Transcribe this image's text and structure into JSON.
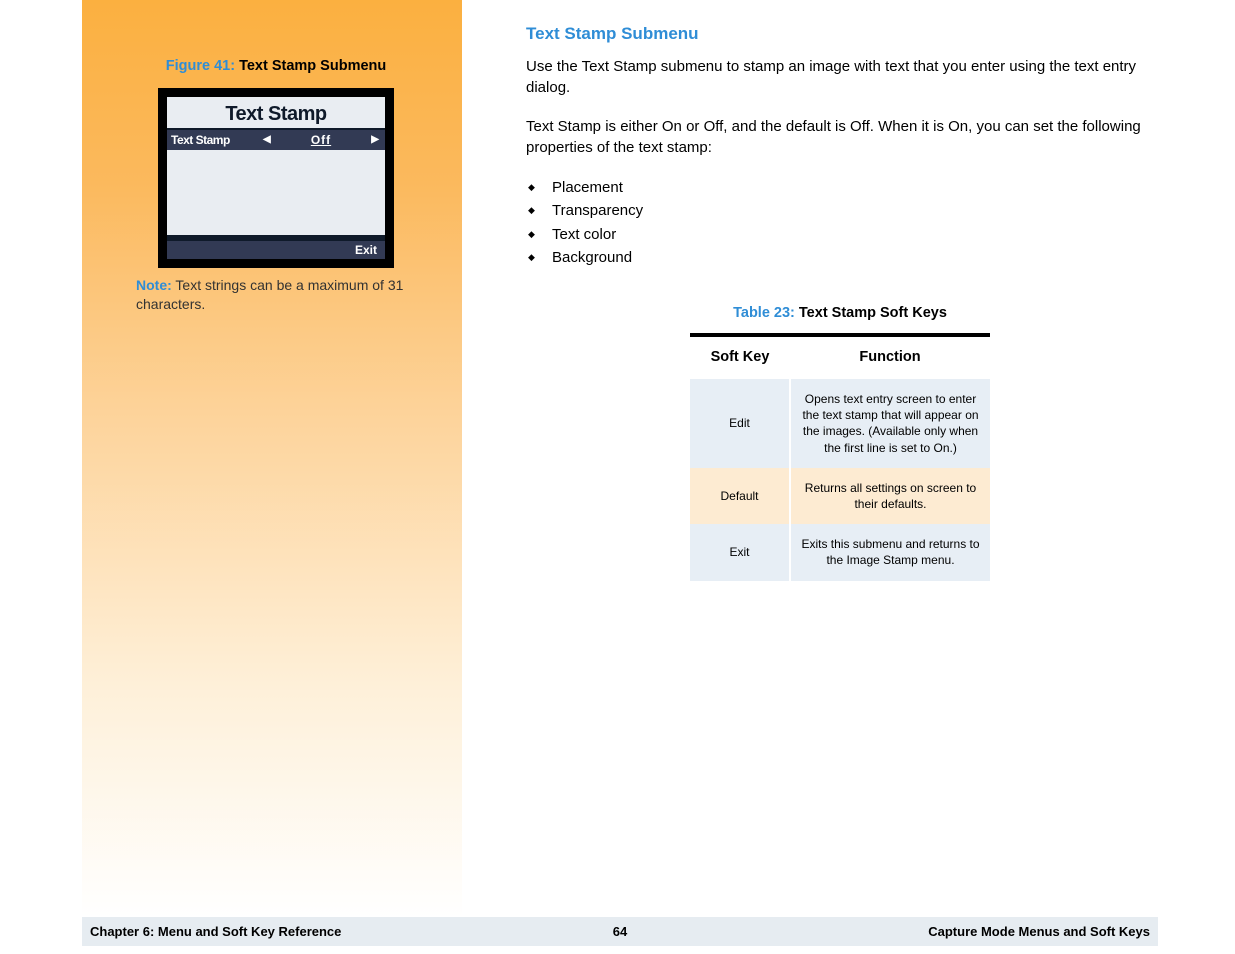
{
  "sidebar": {
    "figure_label": "Figure 41:",
    "figure_title": " Text Stamp Submenu",
    "screenshot": {
      "title": "Text Stamp",
      "row_label": "Text Stamp",
      "row_value": "Off",
      "exit_label": "Exit"
    },
    "note_label": "Note:",
    "note_text": " Text strings can be a maximum of 31 characters."
  },
  "main": {
    "heading": "Text Stamp Submenu",
    "para1": "Use the Text Stamp submenu to stamp an image with text that you enter using the text entry dialog.",
    "para2": "Text Stamp is either On or Off, and the default is Off. When it is On, you can set the following properties of the text stamp:",
    "bullets": [
      "Placement",
      "Transparency",
      "Text color",
      "Background"
    ],
    "table_label": "Table 23:",
    "table_title": " Text Stamp Soft Keys",
    "table_headers": {
      "col1": "Soft Key",
      "col2": "Function"
    },
    "table_rows": [
      {
        "key": "Edit",
        "fn": "Opens text entry screen to enter the text stamp that will appear on the images. (Available only when the first line is set to On.)"
      },
      {
        "key": "Default",
        "fn": "Returns all settings on screen to their defaults."
      },
      {
        "key": "Exit",
        "fn": "Exits this submenu and returns to the Image Stamp menu."
      }
    ]
  },
  "footer": {
    "left": "Chapter 6: Menu and Soft Key Reference",
    "center": "64",
    "right": "Capture Mode Menus and Soft Keys"
  }
}
